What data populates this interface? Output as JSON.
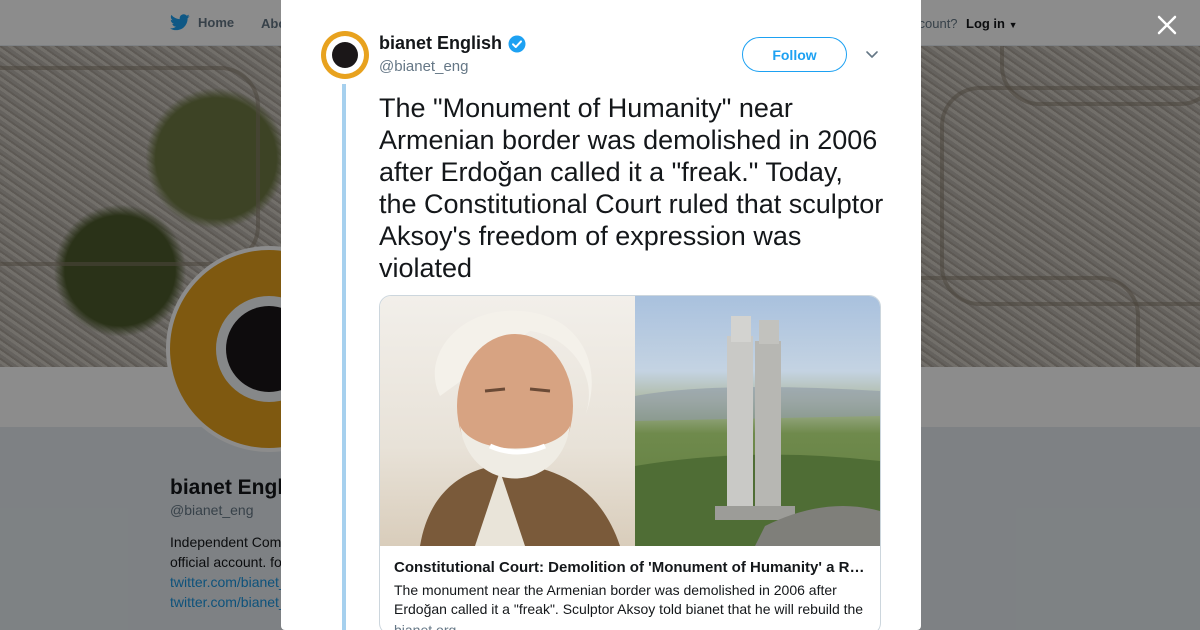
{
  "background": {
    "nav": {
      "home": "Home",
      "about": "Abo",
      "account": "ccount?",
      "login": "Log in"
    },
    "profile": {
      "name": "bianet Engl",
      "handle": "@bianet_eng",
      "bio_line1": "Independent Com",
      "bio_line2": "official account. fo",
      "link1": "twitter.com/bianet_",
      "link2": "twitter.com/bianet_"
    }
  },
  "tweet": {
    "author_name": "bianet English",
    "author_handle": "@bianet_eng",
    "follow_label": "Follow",
    "text": "The \"Monument of Humanity\" near Armenian border was demolished in 2006 after Erdoğan called it a \"freak.\" Today, the Constitutional Court ruled that sculptor Aksoy's freedom of expression was violated",
    "card": {
      "title": "Constitutional Court: Demolition of 'Monument of Humanity' a Right …",
      "description": "The monument near the Armenian border was demolished in 2006 after Erdoğan called it a \"freak\". Sculptor Aksoy told bianet that he will rebuild the",
      "domain": "bianet.org"
    }
  },
  "colors": {
    "accent": "#1da1f2",
    "avatar_ring": "#e8a21e",
    "thread_line": "#a6d0ee"
  }
}
